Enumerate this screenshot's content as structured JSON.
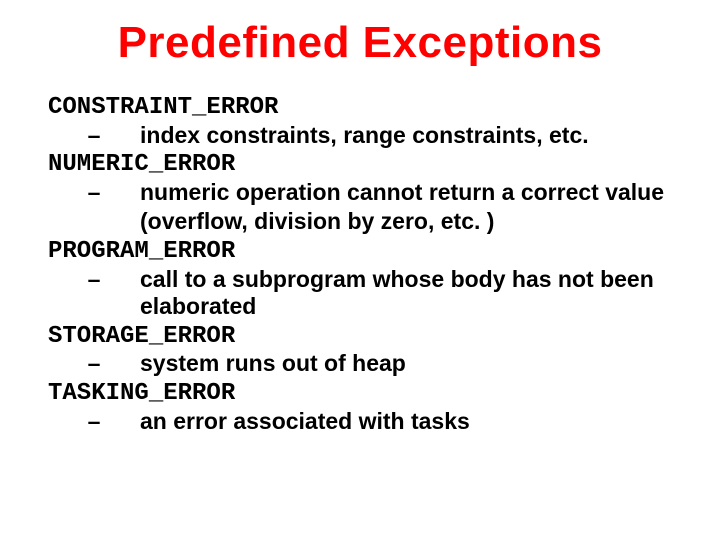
{
  "title": "Predefined Exceptions",
  "bullet": "–",
  "items": [
    {
      "name": "CONSTRAINT_ERROR",
      "lines": [
        "index constraints, range constraints, etc."
      ]
    },
    {
      "name": "NUMERIC_ERROR",
      "lines": [
        "numeric operation cannot return a correct value",
        "(overflow, division by zero, etc. )"
      ]
    },
    {
      "name": "PROGRAM_ERROR",
      "lines": [
        "call to a subprogram whose body has not been elaborated"
      ]
    },
    {
      "name": "STORAGE_ERROR",
      "lines": [
        "system runs out of heap"
      ]
    },
    {
      "name": "TASKING_ERROR",
      "lines": [
        "an error associated with tasks"
      ]
    }
  ]
}
